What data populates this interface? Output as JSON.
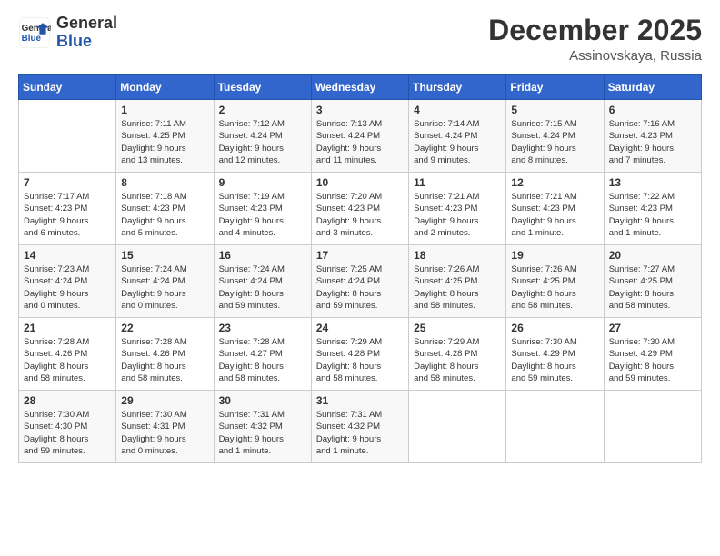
{
  "logo": {
    "text_general": "General",
    "text_blue": "Blue"
  },
  "header": {
    "month": "December 2025",
    "location": "Assinovskaya, Russia"
  },
  "weekdays": [
    "Sunday",
    "Monday",
    "Tuesday",
    "Wednesday",
    "Thursday",
    "Friday",
    "Saturday"
  ],
  "weeks": [
    [
      {
        "day": "",
        "info": ""
      },
      {
        "day": "1",
        "info": "Sunrise: 7:11 AM\nSunset: 4:25 PM\nDaylight: 9 hours\nand 13 minutes."
      },
      {
        "day": "2",
        "info": "Sunrise: 7:12 AM\nSunset: 4:24 PM\nDaylight: 9 hours\nand 12 minutes."
      },
      {
        "day": "3",
        "info": "Sunrise: 7:13 AM\nSunset: 4:24 PM\nDaylight: 9 hours\nand 11 minutes."
      },
      {
        "day": "4",
        "info": "Sunrise: 7:14 AM\nSunset: 4:24 PM\nDaylight: 9 hours\nand 9 minutes."
      },
      {
        "day": "5",
        "info": "Sunrise: 7:15 AM\nSunset: 4:24 PM\nDaylight: 9 hours\nand 8 minutes."
      },
      {
        "day": "6",
        "info": "Sunrise: 7:16 AM\nSunset: 4:23 PM\nDaylight: 9 hours\nand 7 minutes."
      }
    ],
    [
      {
        "day": "7",
        "info": "Sunrise: 7:17 AM\nSunset: 4:23 PM\nDaylight: 9 hours\nand 6 minutes."
      },
      {
        "day": "8",
        "info": "Sunrise: 7:18 AM\nSunset: 4:23 PM\nDaylight: 9 hours\nand 5 minutes."
      },
      {
        "day": "9",
        "info": "Sunrise: 7:19 AM\nSunset: 4:23 PM\nDaylight: 9 hours\nand 4 minutes."
      },
      {
        "day": "10",
        "info": "Sunrise: 7:20 AM\nSunset: 4:23 PM\nDaylight: 9 hours\nand 3 minutes."
      },
      {
        "day": "11",
        "info": "Sunrise: 7:21 AM\nSunset: 4:23 PM\nDaylight: 9 hours\nand 2 minutes."
      },
      {
        "day": "12",
        "info": "Sunrise: 7:21 AM\nSunset: 4:23 PM\nDaylight: 9 hours\nand 1 minute."
      },
      {
        "day": "13",
        "info": "Sunrise: 7:22 AM\nSunset: 4:23 PM\nDaylight: 9 hours\nand 1 minute."
      }
    ],
    [
      {
        "day": "14",
        "info": "Sunrise: 7:23 AM\nSunset: 4:24 PM\nDaylight: 9 hours\nand 0 minutes."
      },
      {
        "day": "15",
        "info": "Sunrise: 7:24 AM\nSunset: 4:24 PM\nDaylight: 9 hours\nand 0 minutes."
      },
      {
        "day": "16",
        "info": "Sunrise: 7:24 AM\nSunset: 4:24 PM\nDaylight: 8 hours\nand 59 minutes."
      },
      {
        "day": "17",
        "info": "Sunrise: 7:25 AM\nSunset: 4:24 PM\nDaylight: 8 hours\nand 59 minutes."
      },
      {
        "day": "18",
        "info": "Sunrise: 7:26 AM\nSunset: 4:25 PM\nDaylight: 8 hours\nand 58 minutes."
      },
      {
        "day": "19",
        "info": "Sunrise: 7:26 AM\nSunset: 4:25 PM\nDaylight: 8 hours\nand 58 minutes."
      },
      {
        "day": "20",
        "info": "Sunrise: 7:27 AM\nSunset: 4:25 PM\nDaylight: 8 hours\nand 58 minutes."
      }
    ],
    [
      {
        "day": "21",
        "info": "Sunrise: 7:28 AM\nSunset: 4:26 PM\nDaylight: 8 hours\nand 58 minutes."
      },
      {
        "day": "22",
        "info": "Sunrise: 7:28 AM\nSunset: 4:26 PM\nDaylight: 8 hours\nand 58 minutes."
      },
      {
        "day": "23",
        "info": "Sunrise: 7:28 AM\nSunset: 4:27 PM\nDaylight: 8 hours\nand 58 minutes."
      },
      {
        "day": "24",
        "info": "Sunrise: 7:29 AM\nSunset: 4:28 PM\nDaylight: 8 hours\nand 58 minutes."
      },
      {
        "day": "25",
        "info": "Sunrise: 7:29 AM\nSunset: 4:28 PM\nDaylight: 8 hours\nand 58 minutes."
      },
      {
        "day": "26",
        "info": "Sunrise: 7:30 AM\nSunset: 4:29 PM\nDaylight: 8 hours\nand 59 minutes."
      },
      {
        "day": "27",
        "info": "Sunrise: 7:30 AM\nSunset: 4:29 PM\nDaylight: 8 hours\nand 59 minutes."
      }
    ],
    [
      {
        "day": "28",
        "info": "Sunrise: 7:30 AM\nSunset: 4:30 PM\nDaylight: 8 hours\nand 59 minutes."
      },
      {
        "day": "29",
        "info": "Sunrise: 7:30 AM\nSunset: 4:31 PM\nDaylight: 9 hours\nand 0 minutes."
      },
      {
        "day": "30",
        "info": "Sunrise: 7:31 AM\nSunset: 4:32 PM\nDaylight: 9 hours\nand 1 minute."
      },
      {
        "day": "31",
        "info": "Sunrise: 7:31 AM\nSunset: 4:32 PM\nDaylight: 9 hours\nand 1 minute."
      },
      {
        "day": "",
        "info": ""
      },
      {
        "day": "",
        "info": ""
      },
      {
        "day": "",
        "info": ""
      }
    ]
  ]
}
